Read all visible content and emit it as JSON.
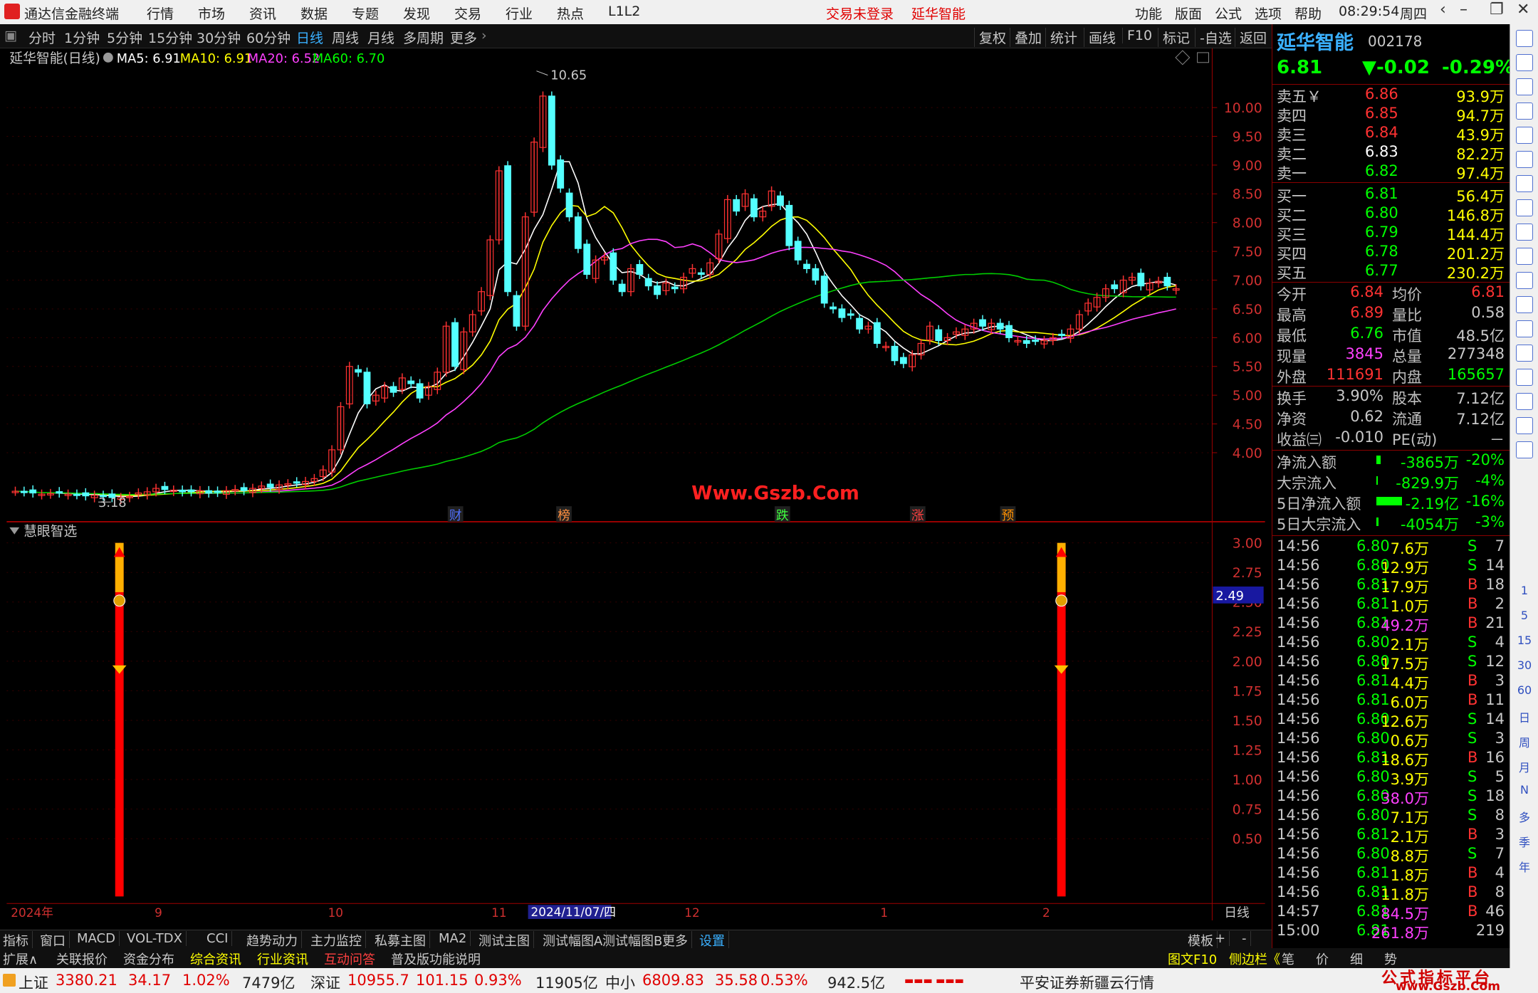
{
  "app": {
    "title": "通达信金融终端",
    "menu": [
      "行情",
      "市场",
      "资讯",
      "数据",
      "专题",
      "发现",
      "交易",
      "行业",
      "热点",
      "L1L2"
    ],
    "notice": "交易未登录",
    "stock_name_top": "延华智能",
    "right_menu": [
      "功能",
      "版面",
      "公式",
      "选项",
      "帮助"
    ],
    "time": "08:29:54",
    "weekday": "周四"
  },
  "periods": {
    "items": [
      "分时",
      "1分钟",
      "5分钟",
      "15分钟",
      "30分钟",
      "60分钟",
      "日线",
      "周线",
      "月线",
      "多周期",
      "更多"
    ],
    "active": "日线",
    "right": [
      "复权",
      "叠加",
      "统计",
      "画线",
      "F10",
      "标记",
      "-自选",
      "返回"
    ]
  },
  "main_chart": {
    "title": "延华智能(日线)",
    "ma": [
      {
        "label": "MA5: 6.91",
        "color": "#ffffff"
      },
      {
        "label": "MA10: 6.91",
        "color": "#ffff00"
      },
      {
        "label": "MA20: 6.52",
        "color": "#ff40ff"
      },
      {
        "label": "MA60: 6.70",
        "color": "#00ff00"
      }
    ],
    "high_label": "10.65",
    "low_label": "3.18",
    "watermark": "Www.Gszb.Com",
    "event_markers": [
      "财",
      "榜",
      "跌",
      "涨",
      "预"
    ],
    "y_ticks": [
      "10.00",
      "9.50",
      "9.00",
      "8.50",
      "8.00",
      "7.50",
      "7.00",
      "6.50",
      "6.00",
      "5.50",
      "5.00",
      "4.50",
      "4.00"
    ],
    "indicator_title": "慧眼智选",
    "indicator_y_ticks": [
      "3.00",
      "2.75",
      "2.50",
      "2.25",
      "2.00",
      "1.75",
      "1.50",
      "1.25",
      "1.00",
      "0.75",
      "0.50"
    ],
    "indicator_value": "2.49",
    "date_labels": [
      "2024年",
      "9",
      "10",
      "11",
      "2024/11/07/四",
      "12",
      "1",
      "2"
    ],
    "period_label": "日线"
  },
  "chart_data": {
    "type": "candlestick",
    "title": "延华智能(日线)",
    "ylim": [
      3.0,
      10.8
    ],
    "indicator": {
      "name": "慧眼智选",
      "signals": [
        {
          "date_index": 0,
          "value": 3.0
        },
        {
          "date_index": 1,
          "value": 3.0
        }
      ],
      "current": 2.49,
      "ylim": [
        0,
        3.0
      ]
    },
    "ma_current": {
      "MA5": 6.91,
      "MA10": 6.91,
      "MA20": 6.52,
      "MA60": 6.7
    },
    "annotations": {
      "high": 10.65,
      "low": 3.18
    }
  },
  "quote": {
    "name": "延华智能",
    "code": "002178",
    "price": "6.81",
    "change": "▼-0.02",
    "pct": "-0.29%",
    "asks": [
      {
        "label": "卖五￥",
        "price": "6.86",
        "vol": "93.9万"
      },
      {
        "label": "卖四",
        "price": "6.85",
        "vol": "94.7万"
      },
      {
        "label": "卖三",
        "price": "6.84",
        "vol": "43.9万"
      },
      {
        "label": "卖二",
        "price": "6.83",
        "vol": "82.2万"
      },
      {
        "label": "卖一",
        "price": "6.82",
        "vol": "97.4万"
      }
    ],
    "bids": [
      {
        "label": "买一",
        "price": "6.81",
        "vol": "56.4万"
      },
      {
        "label": "买二",
        "price": "6.80",
        "vol": "146.8万"
      },
      {
        "label": "买三",
        "price": "6.79",
        "vol": "144.4万"
      },
      {
        "label": "买四",
        "price": "6.78",
        "vol": "201.2万"
      },
      {
        "label": "买五",
        "price": "6.77",
        "vol": "230.2万"
      }
    ],
    "stats": [
      [
        "今开",
        "6.84",
        "均价",
        "6.81"
      ],
      [
        "最高",
        "6.89",
        "量比",
        "0.58"
      ],
      [
        "最低",
        "6.76",
        "市值",
        "48.5亿"
      ],
      [
        "现量",
        "3845",
        "总量",
        "277348"
      ],
      [
        "外盘",
        "111691",
        "内盘",
        "165657"
      ]
    ],
    "stats2": [
      [
        "换手",
        "3.90%",
        "股本",
        "7.12亿"
      ],
      [
        "净资",
        "0.62",
        "流通",
        "7.12亿"
      ],
      [
        "收益㈢",
        "-0.010",
        "PE(动)",
        "－"
      ]
    ],
    "flows": [
      [
        "净流入额",
        "-3865万",
        "-20%"
      ],
      [
        "大宗流入",
        "-829.9万",
        "-4%"
      ],
      [
        "5日净流入额",
        "-2.19亿",
        "-16%"
      ],
      [
        "5日大宗流入",
        "-4054万",
        "-3%"
      ]
    ],
    "ticks": [
      [
        "14:56",
        "6.80",
        "7.6万",
        "S",
        "7"
      ],
      [
        "14:56",
        "6.80",
        "12.9万",
        "S",
        "14"
      ],
      [
        "14:56",
        "6.81",
        "17.9万",
        "B",
        "18"
      ],
      [
        "14:56",
        "6.81",
        "1.0万",
        "B",
        "2"
      ],
      [
        "14:56",
        "6.81",
        "49.2万",
        "B",
        "21"
      ],
      [
        "14:56",
        "6.80",
        "2.1万",
        "S",
        "4"
      ],
      [
        "14:56",
        "6.80",
        "17.5万",
        "S",
        "12"
      ],
      [
        "14:56",
        "6.81",
        "4.4万",
        "B",
        "3"
      ],
      [
        "14:56",
        "6.81",
        "6.0万",
        "B",
        "11"
      ],
      [
        "14:56",
        "6.80",
        "12.6万",
        "S",
        "14"
      ],
      [
        "14:56",
        "6.80",
        "0.6万",
        "S",
        "3"
      ],
      [
        "14:56",
        "6.81",
        "18.6万",
        "B",
        "16"
      ],
      [
        "14:56",
        "6.80",
        "3.9万",
        "S",
        "5"
      ],
      [
        "14:56",
        "6.80",
        "38.0万",
        "S",
        "18"
      ],
      [
        "14:56",
        "6.80",
        "7.1万",
        "S",
        "8"
      ],
      [
        "14:56",
        "6.81",
        "2.1万",
        "B",
        "3"
      ],
      [
        "14:56",
        "6.80",
        "8.8万",
        "S",
        "7"
      ],
      [
        "14:56",
        "6.81",
        "1.8万",
        "B",
        "4"
      ],
      [
        "14:56",
        "6.81",
        "11.8万",
        "B",
        "8"
      ],
      [
        "14:57",
        "6.81",
        "84.5万",
        "B",
        "46"
      ],
      [
        "15:00",
        "6.81",
        "261.8万",
        "",
        "219"
      ]
    ]
  },
  "bottom_tabs": [
    "指标",
    "窗口",
    "MACD",
    "VOL-TDX",
    "CCI",
    "趋势动力",
    "主力监控",
    "私募主图",
    "MA2",
    "测试主图",
    "测试幅图A",
    "测试幅图B",
    "更多",
    "设置"
  ],
  "bottom_tabs_right": [
    "模板",
    "+",
    "-"
  ],
  "bottom_links": [
    "扩展∧",
    "关联报价",
    "资金分布",
    "综合资讯",
    "行业资讯",
    "互动问答",
    "普及版功能说明"
  ],
  "bottom_links_right": [
    "图文F10",
    "侧边栏《",
    "笔",
    "价",
    "细",
    "势"
  ],
  "sidebar_items": [
    "1",
    "5",
    "15",
    "30",
    "60",
    "日",
    "周",
    "月",
    "N",
    "多",
    "季",
    "年"
  ],
  "status": {
    "sh_label": "上证",
    "sh_price": "3380.21",
    "sh_chg": "34.17",
    "sh_pct": "1.02%",
    "sh_amt": "7479亿",
    "sz_label": "深证",
    "sz_price": "10955.7",
    "sz_chg": "101.15",
    "sz_pct": "0.93%",
    "sz_amt": "11905亿",
    "zx_label": "中小",
    "zx_price": "6809.83",
    "zx_chg": "35.58",
    "zx_pct": "0.53%",
    "zx_amt": "942.5亿",
    "broker": "平安证券新疆云行情",
    "watermark": "公式指标平台",
    "watermark_url": "www.Gszb.Com"
  }
}
